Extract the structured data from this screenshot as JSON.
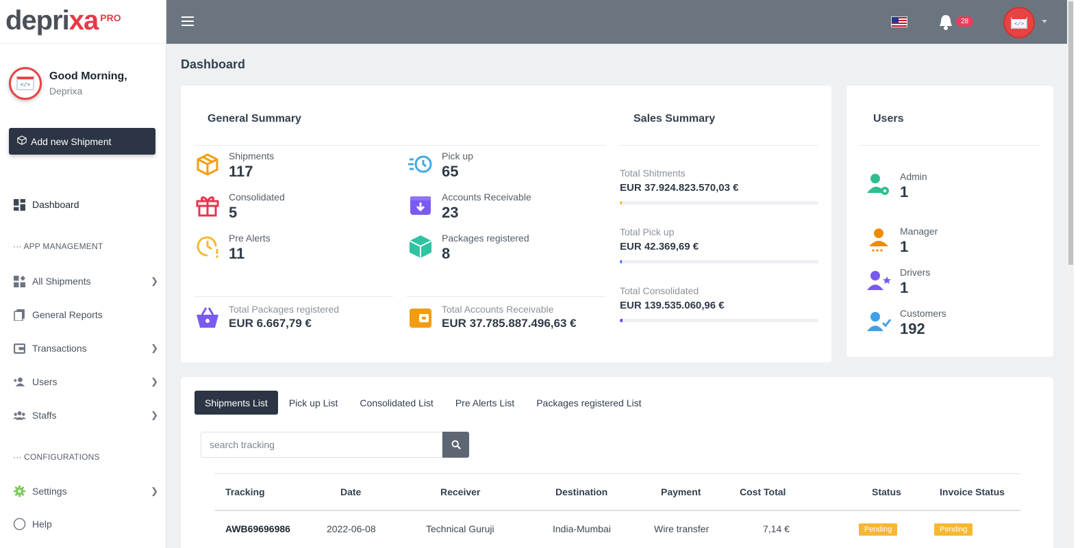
{
  "brand": {
    "name_part1": "depri",
    "name_part2": "xa",
    "pro": "PRO"
  },
  "profile": {
    "greeting": "Good Morning,",
    "name": "Deprixa"
  },
  "sidebar": {
    "add_button": "Add new Shipment",
    "items": [
      {
        "label": "Dashboard",
        "icon": "dashboard-icon"
      },
      {
        "label": "All Shipments",
        "icon": "shipments-icon"
      },
      {
        "label": "General Reports",
        "icon": "reports-icon"
      },
      {
        "label": "Transactions",
        "icon": "wallet-icon"
      },
      {
        "label": "Users",
        "icon": "users-icon"
      },
      {
        "label": "Staffs",
        "icon": "staffs-icon"
      },
      {
        "label": "Settings",
        "icon": "gear-icon"
      },
      {
        "label": "Help",
        "icon": "help-icon"
      }
    ],
    "section_app": "APP MANAGEMENT",
    "section_config": "CONFIGURATIONS"
  },
  "topbar": {
    "notification_count": "28"
  },
  "page": {
    "title": "Dashboard"
  },
  "general_summary": {
    "title": "General Summary",
    "stats": [
      {
        "label": "Shipments",
        "value": "117",
        "color": "#f39c12"
      },
      {
        "label": "Consolidated",
        "value": "5",
        "color": "#e8364f"
      },
      {
        "label": "Pre Alerts",
        "value": "11",
        "color": "#f5b82e"
      },
      {
        "label": "Pick up",
        "value": "65",
        "color": "#3fa9e0"
      },
      {
        "label": "Accounts Receivable",
        "value": "23",
        "color": "#7a5af0"
      },
      {
        "label": "Packages registered",
        "value": "8",
        "color": "#2ec4a3"
      }
    ],
    "totals": [
      {
        "label": "Total Packages registered",
        "value": "EUR 6.667,79 €",
        "color": "#7a5af0"
      },
      {
        "label": "Total Accounts Receivable",
        "value": "EUR 37.785.887.496,63 €",
        "color": "#f39c12"
      }
    ]
  },
  "sales_summary": {
    "title": "Sales Summary",
    "items": [
      {
        "label": "Total Shitments",
        "value": "EUR 37.924.823.570,03 €",
        "progress": 0.01,
        "color": "#f5b82e"
      },
      {
        "label": "Total Pick up",
        "value": "EUR 42.369,69 €",
        "progress": 0.01,
        "color": "#4a6cf7"
      },
      {
        "label": "Total Consolidated",
        "value": "EUR 139.535.060,96 €",
        "progress": 0.015,
        "color": "#6a4cf0"
      }
    ]
  },
  "users": {
    "title": "Users",
    "items": [
      {
        "label": "Admin",
        "value": "1",
        "color": "#2ebf91"
      },
      {
        "label": "Manager",
        "value": "1",
        "color": "#f08a00"
      },
      {
        "label": "Drivers",
        "value": "1",
        "color": "#7a5af0"
      },
      {
        "label": "Customers",
        "value": "192",
        "color": "#3fa0e8"
      }
    ]
  },
  "tabs": [
    "Shipments List",
    "Pick up List",
    "Consolidated List",
    "Pre Alerts List",
    "Packages registered List"
  ],
  "search": {
    "placeholder": "search tracking"
  },
  "table": {
    "headers": [
      "Tracking",
      "Date",
      "Receiver",
      "Destination",
      "Payment",
      "Cost Total",
      "Status",
      "Invoice Status"
    ],
    "rows": [
      {
        "tracking": "AWB69696986",
        "date": "2022-06-08",
        "receiver": "Technical Guruji",
        "destination": "India-Mumbai",
        "payment": "Wire transfer",
        "cost": "7,14 €",
        "status": "Pending",
        "invoice_status": "Pending"
      }
    ]
  }
}
